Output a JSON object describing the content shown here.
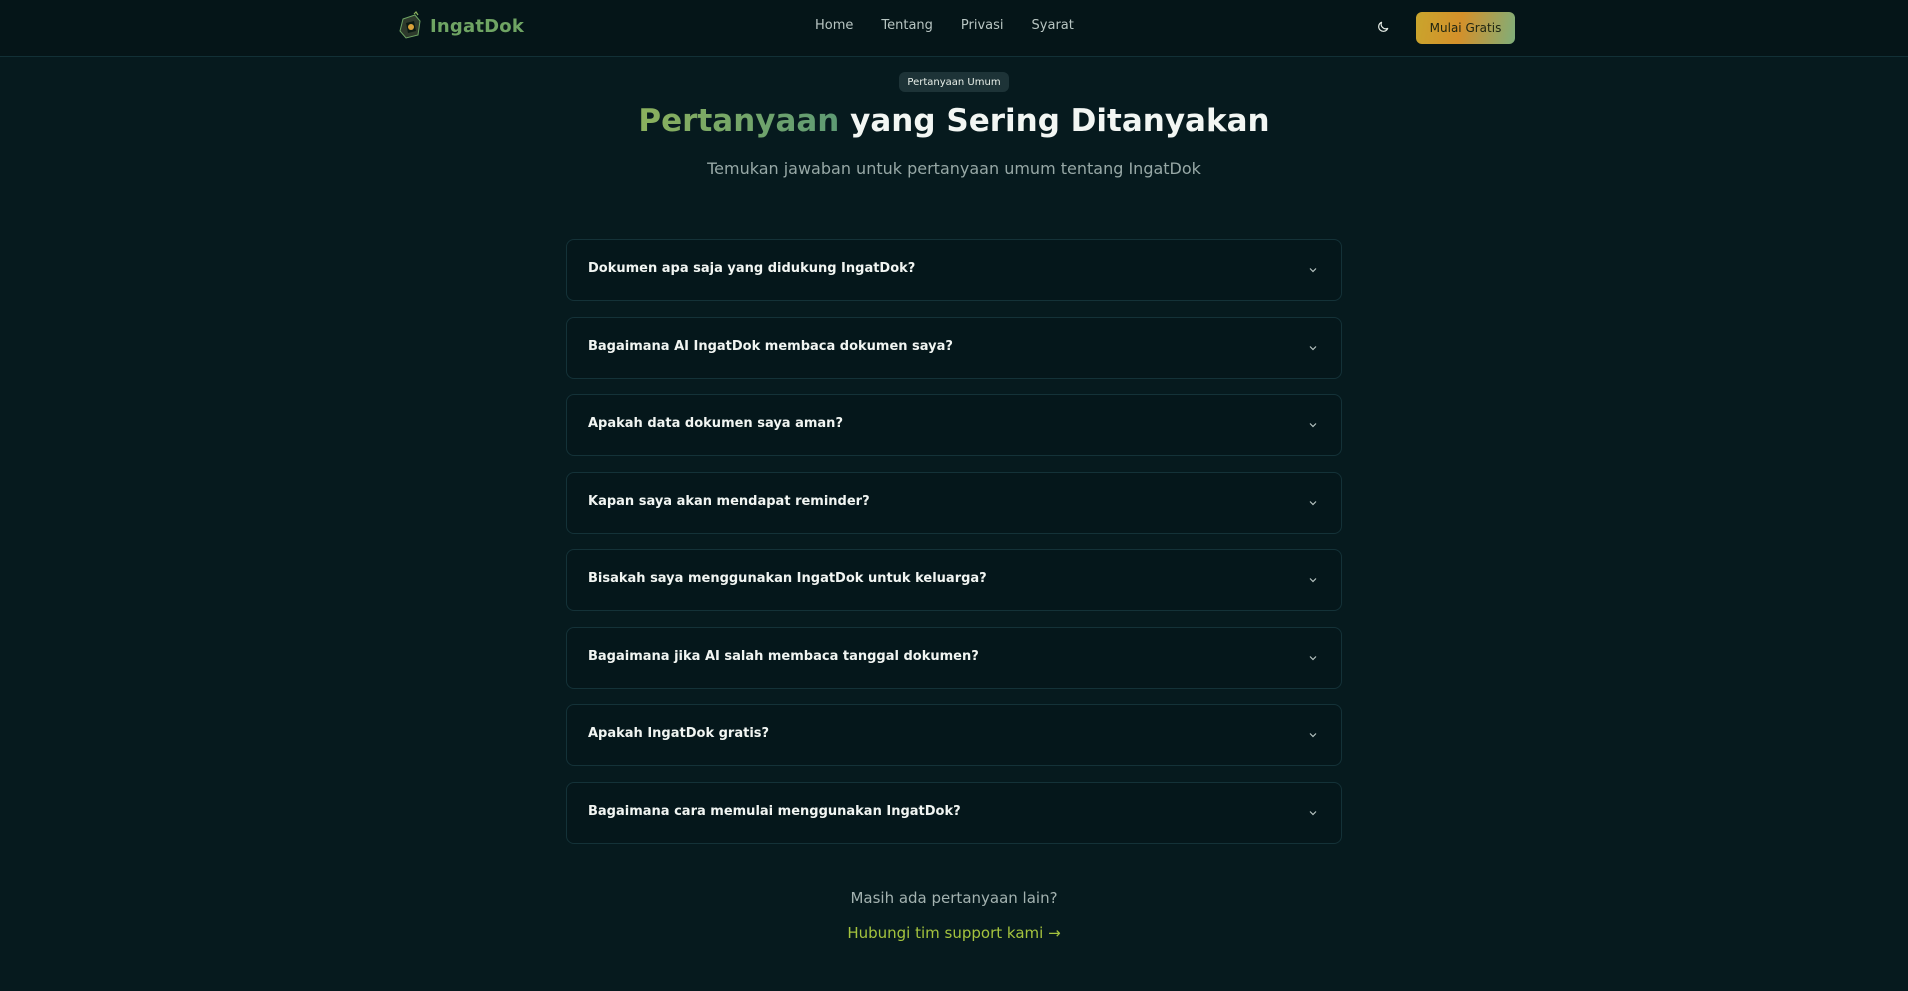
{
  "brand": {
    "name": "IngatDok",
    "accent_color": "#6fa463"
  },
  "nav": {
    "items": [
      "Home",
      "Tentang",
      "Privasi",
      "Syarat"
    ]
  },
  "header": {
    "theme_toggle_icon": "moon-icon",
    "cta_label": "Mulai Gratis"
  },
  "hero": {
    "badge": "Pertanyaan Umum",
    "title_accent": "Pertanyaan",
    "title_rest": " yang Sering Ditanyakan",
    "subtitle": "Temukan jawaban untuk pertanyaan umum tentang IngatDok"
  },
  "faq": {
    "chevron_icon": "chevron-down-icon",
    "items": [
      {
        "question": "Dokumen apa saja yang didukung IngatDok?"
      },
      {
        "question": "Bagaimana AI IngatDok membaca dokumen saya?"
      },
      {
        "question": "Apakah data dokumen saya aman?"
      },
      {
        "question": "Kapan saya akan mendapat reminder?"
      },
      {
        "question": "Bisakah saya menggunakan IngatDok untuk keluarga?"
      },
      {
        "question": "Bagaimana jika AI salah membaca tanggal dokumen?"
      },
      {
        "question": "Apakah IngatDok gratis?"
      },
      {
        "question": "Bagaimana cara memulai menggunakan IngatDok?"
      }
    ]
  },
  "contact": {
    "prompt": "Masih ada pertanyaan lain?",
    "link_label": "Hubungi tim support kami →"
  },
  "colors": {
    "background": "#061a1e",
    "link": "#a4c33e",
    "cta_gradient_start": "#c9a52d",
    "cta_gradient_end": "#7fae7a"
  }
}
